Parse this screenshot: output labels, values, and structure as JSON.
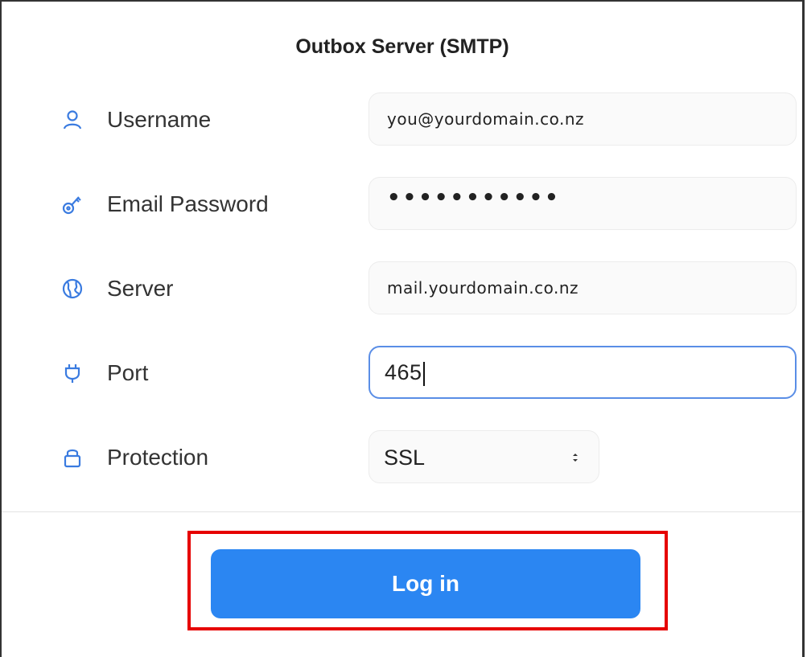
{
  "title": "Outbox Server (SMTP)",
  "fields": {
    "username": {
      "label": "Username",
      "value": "you@yourdomain.co.nz",
      "icon": "user-icon"
    },
    "password": {
      "label": "Email Password",
      "value": "•••••••••••",
      "icon": "key-icon"
    },
    "server": {
      "label": "Server",
      "value": "mail.yourdomain.co.nz",
      "icon": "globe-icon"
    },
    "port": {
      "label": "Port",
      "value": "465",
      "icon": "plug-icon"
    },
    "protection": {
      "label": "Protection",
      "value": "SSL",
      "icon": "lock-icon"
    }
  },
  "login_button": "Log in",
  "colors": {
    "accent": "#2b86f2",
    "icon": "#3a7be0",
    "highlight": "#e60000",
    "focus_border": "#5a8ee6"
  }
}
